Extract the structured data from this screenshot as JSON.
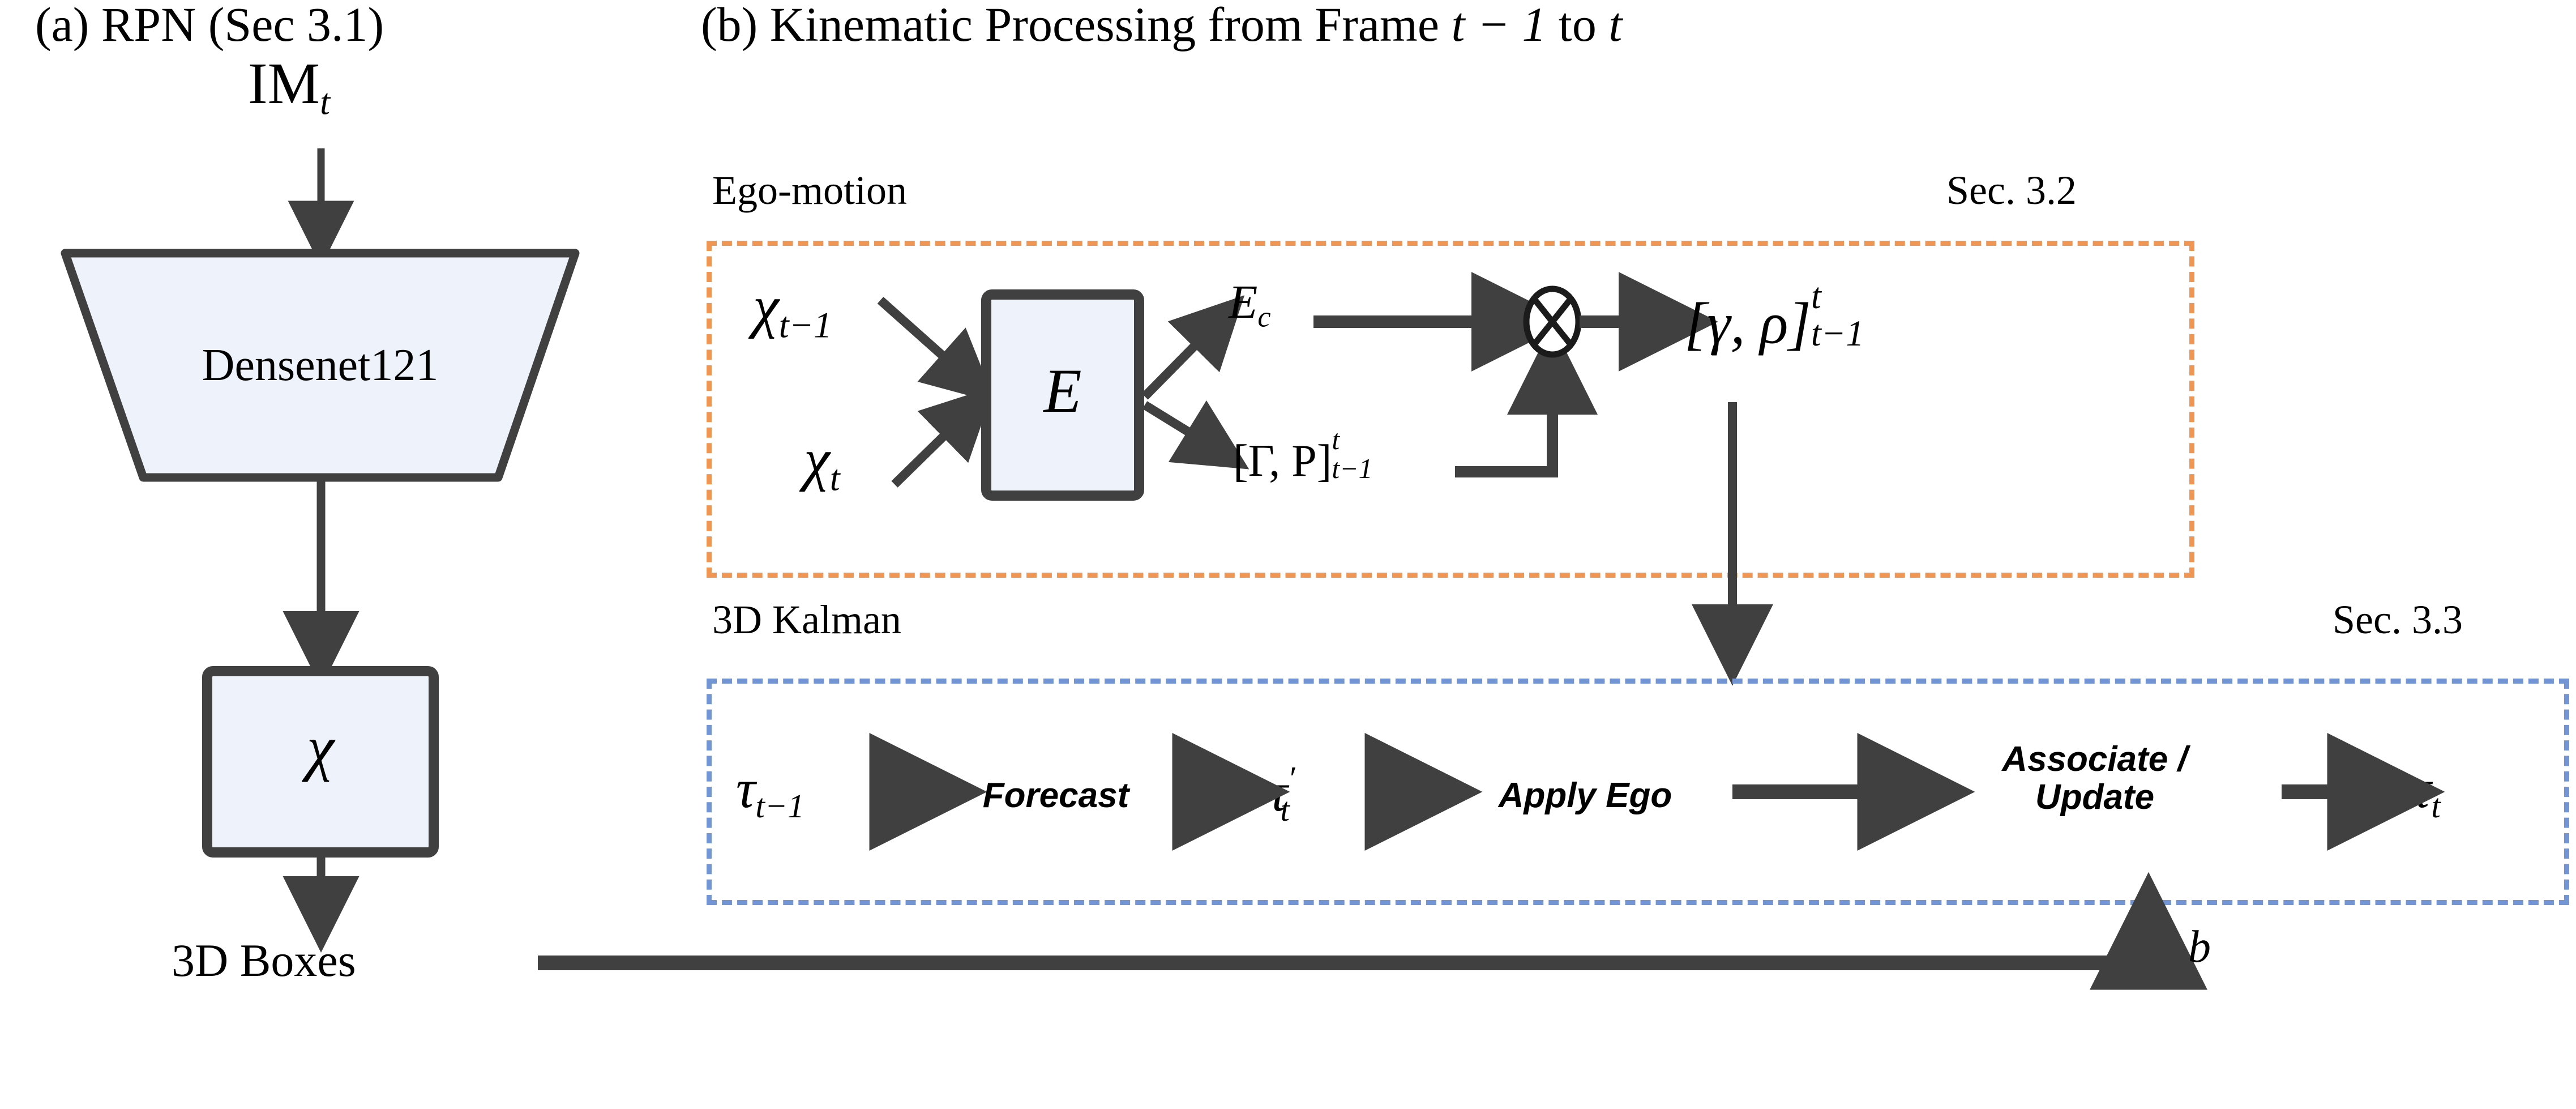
{
  "figure": {
    "panel_a": {
      "title": "(a) RPN (Sec 3.1)",
      "input_label": "IM",
      "input_sub": "t",
      "backbone_label": "Densenet121",
      "feature_label": "χ",
      "output_label": "3D Boxes"
    },
    "panel_b": {
      "title_prefix": "(b) Kinematic Processing from Frame ",
      "title_math": "t − 1",
      "title_suffix": " to ",
      "title_math2": "t",
      "ego": {
        "group_label": "Ego-motion",
        "section_label": "Sec. 3.2",
        "input_top": "χ",
        "input_top_sub": "t−1",
        "input_bottom": "χ",
        "input_bottom_sub": "t",
        "encoder_label": "E",
        "output_top": "E",
        "output_top_sub": "c",
        "output_bottom_open": "[Γ,  P]",
        "output_bottom_sup": "t",
        "output_bottom_sub": "t−1",
        "operator": "⊗",
        "result_open": "[γ,  ρ]",
        "result_sup": "t",
        "result_sub": "t−1"
      },
      "kalman": {
        "group_label": "3D Kalman",
        "section_label": "Sec. 3.3",
        "input_track": "τ",
        "input_track_sub": "t−1",
        "stage_1": "Forecast",
        "mid_track": "τ",
        "mid_track_prime": "′",
        "mid_track_sub": "t",
        "stage_2": "Apply Ego",
        "stage_3_line1": "Associate /",
        "stage_3_line2": "Update",
        "output_track": "τ",
        "output_track_sub": "t",
        "feedback_label": "b"
      }
    },
    "colors": {
      "ego_box_border": "#ef9655",
      "kalman_box_border": "#7495d3",
      "node_fill": "#eef2fb",
      "node_stroke": "#404040",
      "arrow": "#404040",
      "text": "#000000"
    }
  }
}
